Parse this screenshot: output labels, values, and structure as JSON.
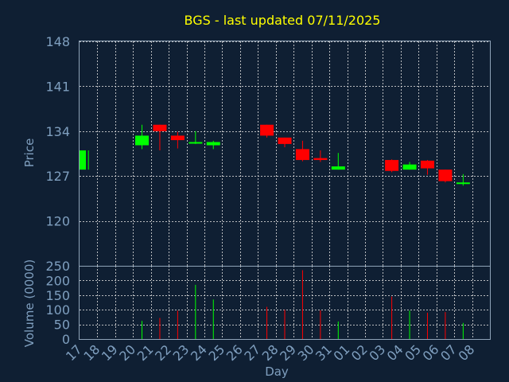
{
  "chart_data": {
    "type": "candlestick",
    "title": "BGS - last updated 07/11/2025",
    "xlabel": "Day",
    "price_panel": {
      "ylabel": "Price",
      "ylim": [
        113,
        148
      ],
      "yticks": [
        148,
        141,
        134,
        127,
        120
      ],
      "grid": true
    },
    "volume_panel": {
      "ylabel": "Volume (0000)",
      "ylim": [
        0,
        250
      ],
      "yticks": [
        250,
        200,
        150,
        100,
        50,
        0
      ],
      "grid": true
    },
    "categories": [
      "17",
      "18",
      "19",
      "20",
      "21",
      "22",
      "23",
      "24",
      "25",
      "26",
      "27",
      "28",
      "29",
      "30",
      "31",
      "01",
      "02",
      "03",
      "04",
      "05",
      "06",
      "07",
      "08"
    ],
    "candles": [
      {
        "day": "17",
        "open": 128.0,
        "close": 131.0,
        "high": 131.0,
        "low": 128.0,
        "color": "#00ff00"
      },
      {
        "day": "20",
        "open": 131.8,
        "close": 133.3,
        "high": 135.0,
        "low": 131.2,
        "color": "#00ff00"
      },
      {
        "day": "21",
        "open": 135.0,
        "close": 134.0,
        "high": 135.0,
        "low": 131.0,
        "color": "#ff0000"
      },
      {
        "day": "22",
        "open": 133.3,
        "close": 132.6,
        "high": 133.9,
        "low": 131.3,
        "color": "#ff0000"
      },
      {
        "day": "23",
        "open": 132.1,
        "close": 132.3,
        "high": 134.0,
        "low": 132.0,
        "color": "#00ff00"
      },
      {
        "day": "24",
        "open": 131.8,
        "close": 132.3,
        "high": 132.5,
        "low": 131.2,
        "color": "#00ff00"
      },
      {
        "day": "27",
        "open": 135.0,
        "close": 133.3,
        "high": 135.0,
        "low": 133.0,
        "color": "#ff0000"
      },
      {
        "day": "28",
        "open": 133.0,
        "close": 132.0,
        "high": 133.0,
        "low": 131.5,
        "color": "#ff0000"
      },
      {
        "day": "29",
        "open": 131.2,
        "close": 129.5,
        "high": 132.5,
        "low": 129.3,
        "color": "#ff0000"
      },
      {
        "day": "30",
        "open": 129.8,
        "close": 129.5,
        "high": 131.0,
        "low": 129.2,
        "color": "#ff0000"
      },
      {
        "day": "31",
        "open": 128.0,
        "close": 128.5,
        "high": 130.6,
        "low": 128.0,
        "color": "#00ff00"
      },
      {
        "day": "03",
        "open": 129.5,
        "close": 127.8,
        "high": 129.6,
        "low": 127.6,
        "color": "#ff0000"
      },
      {
        "day": "04",
        "open": 128.0,
        "close": 128.8,
        "high": 129.2,
        "low": 128.0,
        "color": "#00ff00"
      },
      {
        "day": "05",
        "open": 129.4,
        "close": 128.2,
        "high": 129.5,
        "low": 127.2,
        "color": "#ff0000"
      },
      {
        "day": "06",
        "open": 128.0,
        "close": 126.2,
        "high": 128.0,
        "low": 126.0,
        "color": "#ff0000"
      },
      {
        "day": "07",
        "open": 125.8,
        "close": 126.0,
        "high": 127.3,
        "low": 125.5,
        "color": "#00ff00"
      }
    ],
    "volumes": [
      {
        "day": "20",
        "value": 62,
        "color": "#00ff00"
      },
      {
        "day": "21",
        "value": 72,
        "color": "#ff0000"
      },
      {
        "day": "22",
        "value": 97,
        "color": "#ff0000"
      },
      {
        "day": "23",
        "value": 185,
        "color": "#00ff00"
      },
      {
        "day": "24",
        "value": 135,
        "color": "#00ff00"
      },
      {
        "day": "27",
        "value": 110,
        "color": "#ff0000"
      },
      {
        "day": "28",
        "value": 100,
        "color": "#ff0000"
      },
      {
        "day": "29",
        "value": 235,
        "color": "#ff0000"
      },
      {
        "day": "30",
        "value": 98,
        "color": "#ff0000"
      },
      {
        "day": "31",
        "value": 60,
        "color": "#00ff00"
      },
      {
        "day": "03",
        "value": 145,
        "color": "#ff0000"
      },
      {
        "day": "04",
        "value": 97,
        "color": "#00ff00"
      },
      {
        "day": "05",
        "value": 90,
        "color": "#ff0000"
      },
      {
        "day": "06",
        "value": 92,
        "color": "#ff0000"
      },
      {
        "day": "07",
        "value": 55,
        "color": "#00ff00"
      }
    ]
  }
}
